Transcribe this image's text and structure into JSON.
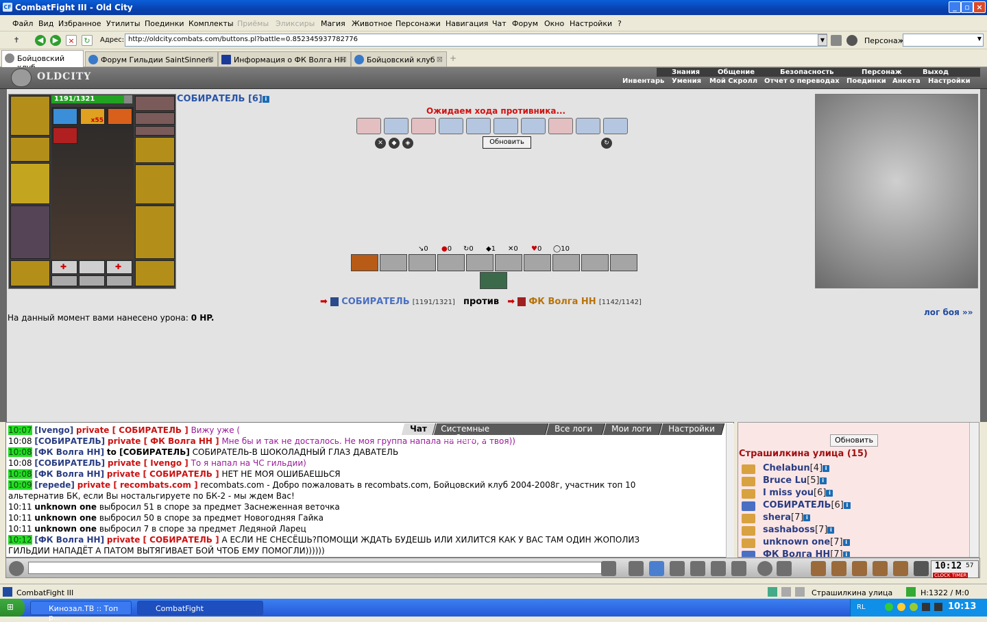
{
  "window": {
    "title": "CombatFight III - Old City",
    "app_icon": "CF"
  },
  "menu": [
    "Файл",
    "Вид",
    "Избранное",
    "Утилиты",
    "Поединки",
    "Комплекты",
    "Приёмы",
    "Эликсиры",
    "Магия",
    "Животное",
    "Персонажи",
    "Навигация",
    "Чат",
    "Форум",
    "Окно",
    "Настройки",
    "?"
  ],
  "menu_disabled": [
    "Приёмы",
    "Эликсиры"
  ],
  "address": {
    "label": "Адрес:",
    "url": "http://oldcity.combats.com/buttons.pl?battle=0.852345937782776",
    "persona_label": "Персонаж:"
  },
  "tabs": [
    {
      "label": "Бойцовский клуб",
      "active": true
    },
    {
      "label": "Форум Гильдии SaintSinners"
    },
    {
      "label": "Информация о ФК Волга НН"
    },
    {
      "label": "Бойцовский клуб"
    }
  ],
  "nav_top": [
    "Знания",
    "Общение",
    "Безопасность",
    "Персонаж",
    "Выход"
  ],
  "nav_bottom": [
    "Инвентарь",
    "Умения",
    "Мой Скролл",
    "Отчет о переводах",
    "Поединки",
    "Анкета",
    "Настройки"
  ],
  "logo": "OLDCITY",
  "player": {
    "name": "СОБИРАТЕЛЬ [6]",
    "hp": "1191/1321",
    "hp_fraction": 0.9,
    "buff_count": "x55"
  },
  "battle": {
    "waiting": "Ожидаем хода противника...",
    "refresh": "Обновить",
    "counters": [
      "0",
      "0",
      "0",
      "1",
      "0",
      "0",
      "10"
    ],
    "vs_word": "против",
    "player_name": "СОБИРАТЕЛЬ",
    "player_hp": "[1191/1321]",
    "enemy_name": "ФК Волга НН",
    "enemy_hp": "[1142/1142]",
    "damage_prefix": "На данный момент вами нанесено урона: ",
    "damage_value": "0 HP.",
    "log_link": "лог боя »»"
  },
  "chat_tabs": [
    "Чат",
    "Системные сообщения",
    "Все логи",
    "Мои логи",
    "Настройки"
  ],
  "chat": [
    {
      "time": "10:07",
      "hl": true,
      "nick": "[Ivengo]",
      "priv": "private [ СОБИРАТЕЛЬ ]",
      "msg": "Вижу уже (",
      "pm": true
    },
    {
      "time": "10:08",
      "hl": false,
      "nick": "[СОБИРАТЕЛЬ]",
      "priv": "private [ ФК Волга НН ]",
      "msg": "Мне бы и так не досталось. Не моя группа напала на него, а твоя))",
      "pm": true
    },
    {
      "time": "10:08",
      "hl": true,
      "nick": "[ФК Волга НН]",
      "priv": "to [СОБИРАТЕЛЬ]",
      "msg": "СОБИРАТЕЛЬ-В ШОКОЛАДНЫЙ ГЛАЗ ДАВАТЕЛЬ",
      "pm": false,
      "to": true
    },
    {
      "time": "10:08",
      "hl": false,
      "nick": "[СОБИРАТЕЛЬ]",
      "priv": "private [ Ivengo ]",
      "msg": "То я напал на ЧС гильдии)",
      "pm": true
    },
    {
      "time": "10:08",
      "hl": true,
      "nick": "[ФК Волга НН]",
      "priv": "private [ СОБИРАТЕЛЬ ]",
      "msg": "НЕТ НЕ МОЯ ОШИБАЕШЬСЯ",
      "pm": false
    },
    {
      "time": "10:09",
      "hl": true,
      "nick": "[repede]",
      "priv": "private [ recombats.com ]",
      "msg": "recombats.com - Добро пожаловать в recombats.com, Бойцовский клуб 2004-2008г, участник топ 10",
      "pm": false
    },
    {
      "time": "",
      "hl": false,
      "nick": "",
      "priv": "",
      "msg": "альтернатив БК, если Вы ностальгируете по БК-2 - мы ждем Вас!",
      "pm": false
    },
    {
      "time": "10:11",
      "hl": false,
      "nick": "unknown one",
      "priv": "",
      "msg": "выбросил 51 в споре за предмет Заснеженная веточка",
      "pm": false,
      "plainnick": true
    },
    {
      "time": "10:11",
      "hl": false,
      "nick": "unknown one",
      "priv": "",
      "msg": "выбросил 50 в споре за предмет Новогодняя Гайка",
      "pm": false,
      "plainnick": true
    },
    {
      "time": "10:11",
      "hl": false,
      "nick": "unknown one",
      "priv": "",
      "msg": "выбросил 7 в споре за предмет Ледяной Ларец",
      "pm": false,
      "plainnick": true
    },
    {
      "time": "10:12",
      "hl": true,
      "nick": "[ФК Волга НН]",
      "priv": "private [ СОБИРАТЕЛЬ ]",
      "msg": "А ЕСЛИ НЕ СНЕСЁШЬ?ПОМОЩИ ЖДАТЬ БУДЕШЬ ИЛИ ХИЛИТСЯ КАК У ВАС ТАМ ОДИН ЖОПОЛИЗ",
      "pm": false
    },
    {
      "time": "",
      "hl": false,
      "nick": "",
      "priv": "",
      "msg": "ГИЛЬДИИ НАПАДЁТ А ПАТОМ ВЫТЯГИВАЕТ БОЙ ЧТОБ ЕМУ ПОМОГЛИ))))))",
      "pm": false
    }
  ],
  "users_panel": {
    "refresh": "Обновить",
    "location": "Страшилкина улица (15)",
    "users": [
      {
        "name": "Chelabun",
        "lvl": "[4]",
        "team": "gold"
      },
      {
        "name": "Bruce Lu",
        "lvl": "[5]",
        "team": "gold"
      },
      {
        "name": "I miss you",
        "lvl": "[6]",
        "team": "gold"
      },
      {
        "name": "СОБИРАТЕЛЬ",
        "lvl": "[6]",
        "team": "blue"
      },
      {
        "name": "shera",
        "lvl": "[7]",
        "team": "gold"
      },
      {
        "name": "sashaboss",
        "lvl": "[7]",
        "team": "gold"
      },
      {
        "name": "unknown one",
        "lvl": "[7]",
        "team": "gold"
      },
      {
        "name": "ФК Волга НН",
        "lvl": "[7]",
        "team": "blue"
      }
    ]
  },
  "clock": {
    "time": "10:12",
    "sec": "57",
    "label": "CLOCK TIMER"
  },
  "statusbar": {
    "app": "CombatFight III",
    "location": "Страшилкина улица",
    "hp": "H:1322 / M:0"
  },
  "taskbar": {
    "items": [
      "Кинозал.ТВ :: Топ р...",
      "CombatFight"
    ],
    "lang": "RL",
    "time": "10:13"
  }
}
